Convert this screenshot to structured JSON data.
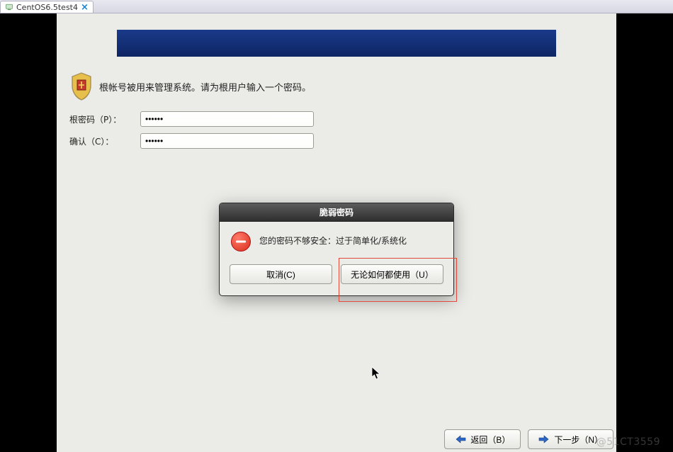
{
  "tab": {
    "title": "CentOS6.5test4",
    "close_glyph": "×"
  },
  "intro": {
    "text": "根帐号被用来管理系统。请为根用户输入一个密码。"
  },
  "form": {
    "password_label": "根密码（P）：",
    "password_value": "••••••",
    "confirm_label": "确认（C）：",
    "confirm_value": "••••••"
  },
  "dialog": {
    "title": "脆弱密码",
    "message": "您的密码不够安全：过于简单化/系统化",
    "cancel_label": "取消(C)",
    "use_anyway_label": "无论如何都使用（U）"
  },
  "nav": {
    "back_label": "返回（B）",
    "next_label": "下一步（N）"
  },
  "watermark": "@51CT3559"
}
